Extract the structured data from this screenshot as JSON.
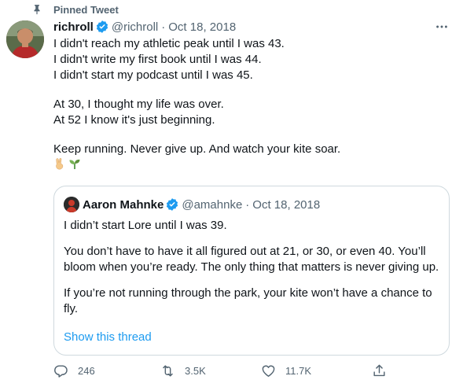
{
  "pinned": {
    "label": "Pinned Tweet",
    "icon": "pin-icon"
  },
  "tweet": {
    "author_name": "richroll",
    "handle": "@richroll",
    "separator": "·",
    "date": "Oct 18, 2018",
    "lines": {
      "l1": "I didn't reach my athletic peak until I was 43.",
      "l2": "I didn't write my first book until I was 44.",
      "l3": "I didn't start my podcast until I was 45.",
      "l4": "At 30, I thought my life was over.",
      "l5": "At 52 I know it's just beginning.",
      "l6": "Keep running. Never give up. And watch your kite soar."
    },
    "emojis": [
      "victory-hand-icon",
      "seedling-icon"
    ]
  },
  "quote": {
    "author_name": "Aaron Mahnke",
    "handle": "@amahnke",
    "separator": "·",
    "date": "Oct 18, 2018",
    "lines": {
      "l1": "I didn’t start Lore until I was 39.",
      "l2": "You don’t have to have it all figured out at 21, or 30, or even 40. You’ll",
      "l3": "bloom when you’re ready. The only thing that matters is never giving up.",
      "l4": "If you’re not running through the park, your kite won’t have a chance to",
      "l5": "fly."
    },
    "show_thread": "Show this thread"
  },
  "actions": {
    "replies": "246",
    "retweets": "3.5K",
    "likes": "11.7K"
  },
  "colors": {
    "accent": "#1d9bf0",
    "muted": "#536471",
    "border": "#cfd9de",
    "text": "#0f1419"
  }
}
